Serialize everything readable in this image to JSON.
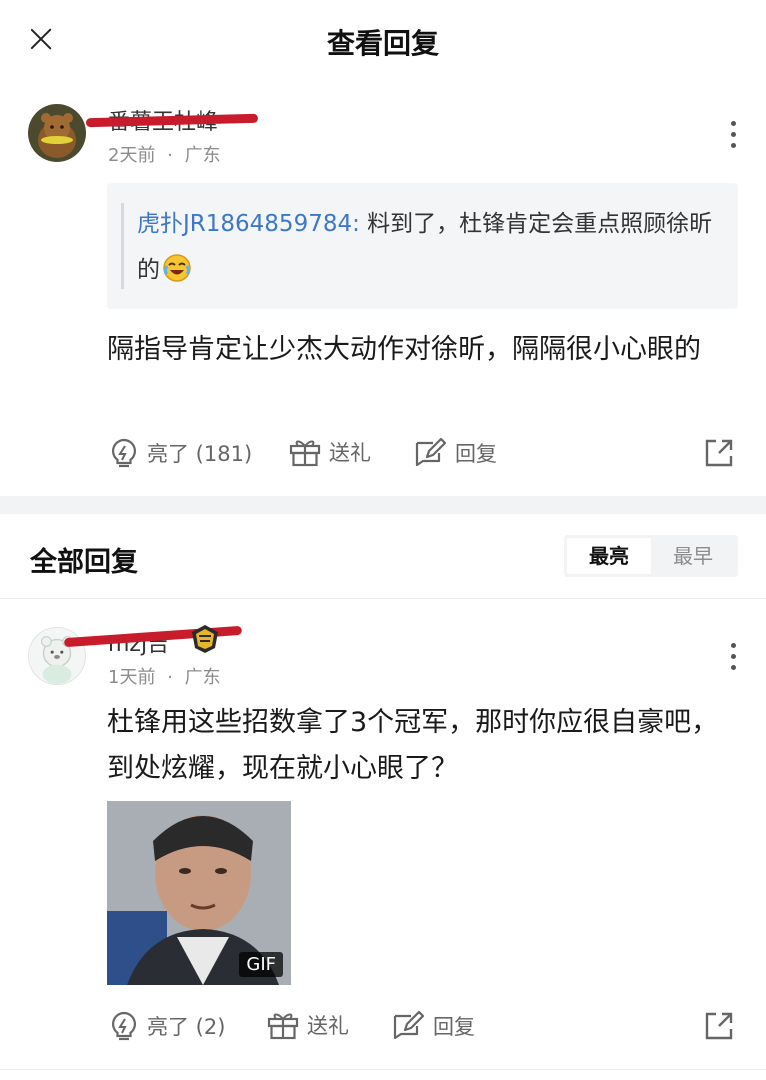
{
  "header": {
    "title": "查看回复"
  },
  "main_comment": {
    "username": "番薯王杜峰",
    "time": "2天前",
    "separator": "·",
    "location": "广东",
    "quote": {
      "author": "虎扑JR1864859784:",
      "text": " 料到了，杜锋肯定会重点照顾徐昕的",
      "emoji": "laughing-crying-emoji"
    },
    "text": "隔指导肯定让少杰大动作对徐昕，隔隔很小心眼的",
    "actions": {
      "light": "亮了 (181)",
      "gift": "送礼",
      "reply": "回复"
    }
  },
  "all_replies": {
    "title": "全部回复",
    "sort": {
      "active": "最亮",
      "inactive": "最早"
    }
  },
  "reply_1": {
    "username": "mzj吉",
    "time": "1天前",
    "separator": "·",
    "location": "广东",
    "text": "杜锋用这些招数拿了3个冠军，那时你应很自豪吧，到处炫耀，现在就小心眼了？",
    "gif_label": "GIF",
    "actions": {
      "light": "亮了 (2)",
      "gift": "送礼",
      "reply": "回复"
    }
  },
  "colors": {
    "link": "#3d78c8",
    "redaction": "#c81c2c",
    "meta": "#8c8c8c"
  }
}
